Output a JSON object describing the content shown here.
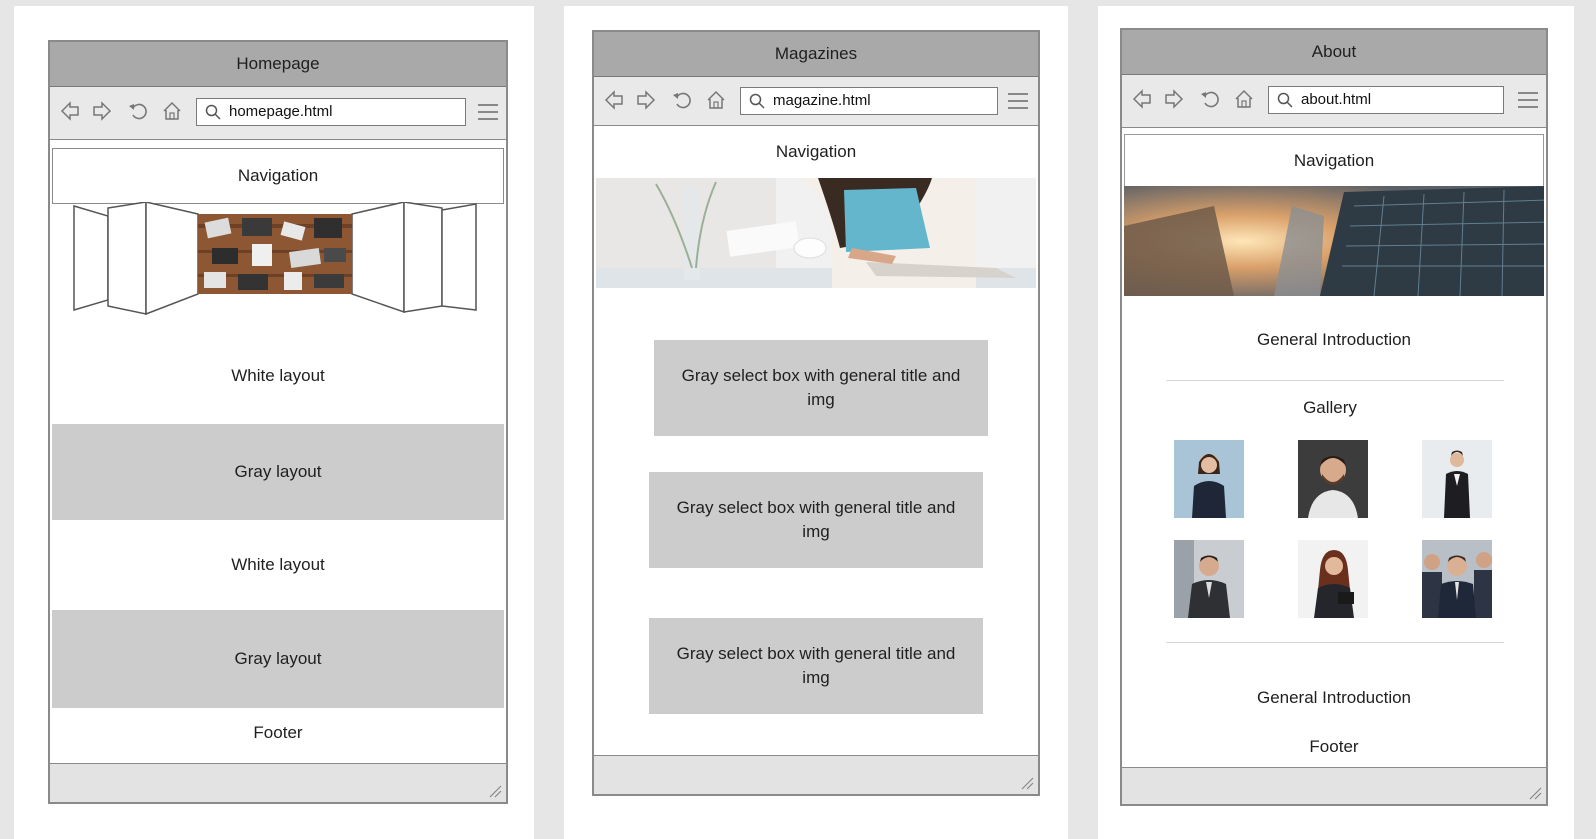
{
  "homepage": {
    "window_title": "Homepage",
    "url": "homepage.html",
    "nav_label": "Navigation",
    "sections": [
      "White layout",
      "Gray layout",
      "White layout",
      "Gray layout"
    ],
    "footer_label": "Footer"
  },
  "magazines": {
    "window_title": "Magazines",
    "url": "magazine.html",
    "nav_label": "Navigation",
    "boxes": [
      "Gray select box with general title and img",
      "Gray select box with general title and img",
      "Gray select box with general title and img"
    ]
  },
  "about": {
    "window_title": "About",
    "url": "about.html",
    "nav_label": "Navigation",
    "intro_top": "General Introduction",
    "gallery_label": "Gallery",
    "intro_bottom": "General Introduction",
    "footer_label": "Footer"
  },
  "icons": [
    "back-icon",
    "forward-icon",
    "refresh-icon",
    "home-icon",
    "search-icon",
    "menu-icon",
    "resize-grip-icon"
  ],
  "colors": {
    "titlebar": "#a9a9a9",
    "gray_layout": "#cccccc",
    "toolbar": "#e9e9e9",
    "background": "#e6e6e6"
  }
}
